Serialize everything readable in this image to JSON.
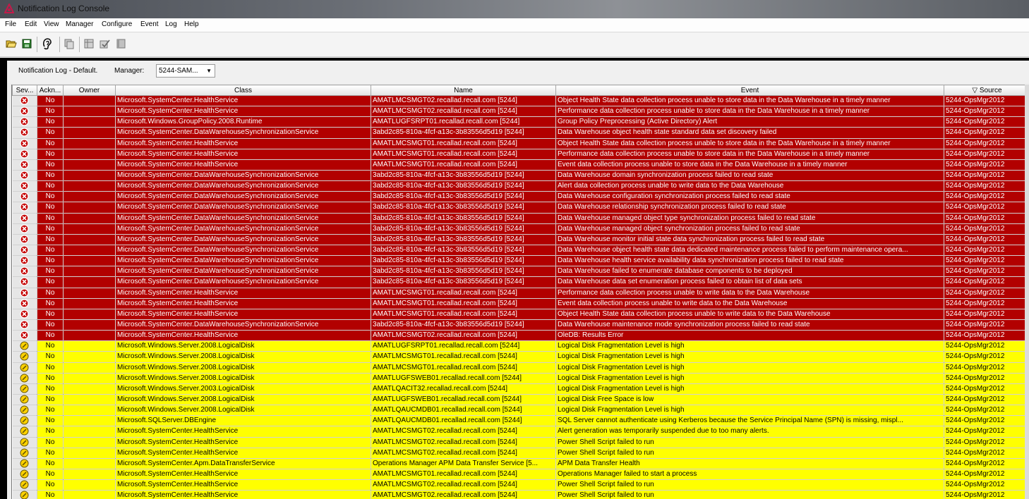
{
  "window": {
    "title": "Notification Log Console"
  },
  "menu": [
    "File",
    "Edit",
    "View",
    "Manager",
    "Configure",
    "Event",
    "Log",
    "Help"
  ],
  "toolbar": [
    "open-folder-icon",
    "save-icon",
    "ear-icon",
    "copy-icon",
    "grid-icon",
    "edit-check-icon",
    "book-icon"
  ],
  "filter": {
    "label": "Notification Log - Default.",
    "manager_label": "Manager:",
    "manager_value": "5244-SAM..."
  },
  "colors": {
    "critical": "#b20000",
    "warning": "#ffff00"
  },
  "columns": [
    "Sev...",
    "Ackn...",
    "Owner",
    "Class",
    "Name",
    "Event",
    "Source"
  ],
  "sort": {
    "column": "Source",
    "indicator": "▽"
  },
  "rows": [
    {
      "severity": "critical",
      "ack": "No",
      "owner": "",
      "class": "Microsoft.SystemCenter.HealthService",
      "name": "AMATLMCSMGT02.recallad.recall.com [5244]",
      "event": "Object Health State data collection process unable to store data in the Data Warehouse in a timely manner",
      "source": "5244-OpsMgr2012"
    },
    {
      "severity": "critical",
      "ack": "No",
      "owner": "",
      "class": "Microsoft.SystemCenter.HealthService",
      "name": "AMATLMCSMGT02.recallad.recall.com [5244]",
      "event": "Performance data collection process unable to store data in the Data Warehouse in a timely manner",
      "source": "5244-OpsMgr2012"
    },
    {
      "severity": "critical",
      "ack": "No",
      "owner": "",
      "class": "Microsoft.Windows.GroupPolicy.2008.Runtime",
      "name": "AMATLUGFSRPT01.recallad.recall.com [5244]",
      "event": "Group Policy Preprocessing (Active Directory) Alert",
      "source": "5244-OpsMgr2012"
    },
    {
      "severity": "critical",
      "ack": "No",
      "owner": "",
      "class": "Microsoft.SystemCenter.DataWarehouseSynchronizationService",
      "name": "3abd2c85-810a-4fcf-a13c-3b83556d5d19 [5244]",
      "event": "Data Warehouse object health state standard data set discovery failed",
      "source": "5244-OpsMgr2012"
    },
    {
      "severity": "critical",
      "ack": "No",
      "owner": "",
      "class": "Microsoft.SystemCenter.HealthService",
      "name": "AMATLMCSMGT01.recallad.recall.com [5244]",
      "event": "Object Health State data collection process unable to store data in the Data Warehouse in a timely manner",
      "source": "5244-OpsMgr2012"
    },
    {
      "severity": "critical",
      "ack": "No",
      "owner": "",
      "class": "Microsoft.SystemCenter.HealthService",
      "name": "AMATLMCSMGT01.recallad.recall.com [5244]",
      "event": "Performance data collection process unable to store data in the Data Warehouse in a timely manner",
      "source": "5244-OpsMgr2012"
    },
    {
      "severity": "critical",
      "ack": "No",
      "owner": "",
      "class": "Microsoft.SystemCenter.HealthService",
      "name": "AMATLMCSMGT01.recallad.recall.com [5244]",
      "event": "Event data collection process unable to store data in the Data Warehouse in a timely manner",
      "source": "5244-OpsMgr2012"
    },
    {
      "severity": "critical",
      "ack": "No",
      "owner": "",
      "class": "Microsoft.SystemCenter.DataWarehouseSynchronizationService",
      "name": "3abd2c85-810a-4fcf-a13c-3b83556d5d19 [5244]",
      "event": "Data Warehouse domain synchronization process failed to read state",
      "source": "5244-OpsMgr2012"
    },
    {
      "severity": "critical",
      "ack": "No",
      "owner": "",
      "class": "Microsoft.SystemCenter.DataWarehouseSynchronizationService",
      "name": "3abd2c85-810a-4fcf-a13c-3b83556d5d19 [5244]",
      "event": "Alert data collection process unable to write data to the Data Warehouse",
      "source": "5244-OpsMgr2012"
    },
    {
      "severity": "critical",
      "ack": "No",
      "owner": "",
      "class": "Microsoft.SystemCenter.DataWarehouseSynchronizationService",
      "name": "3abd2c85-810a-4fcf-a13c-3b83556d5d19 [5244]",
      "event": "Data Warehouse configuration synchronization process failed to read state",
      "source": "5244-OpsMgr2012"
    },
    {
      "severity": "critical",
      "ack": "No",
      "owner": "",
      "class": "Microsoft.SystemCenter.DataWarehouseSynchronizationService",
      "name": "3abd2c85-810a-4fcf-a13c-3b83556d5d19 [5244]",
      "event": "Data Warehouse relationship synchronization process failed to read state",
      "source": "5244-OpsMgr2012"
    },
    {
      "severity": "critical",
      "ack": "No",
      "owner": "",
      "class": "Microsoft.SystemCenter.DataWarehouseSynchronizationService",
      "name": "3abd2c85-810a-4fcf-a13c-3b83556d5d19 [5244]",
      "event": "Data Warehouse managed object type synchronization process failed to read state",
      "source": "5244-OpsMgr2012"
    },
    {
      "severity": "critical",
      "ack": "No",
      "owner": "",
      "class": "Microsoft.SystemCenter.DataWarehouseSynchronizationService",
      "name": "3abd2c85-810a-4fcf-a13c-3b83556d5d19 [5244]",
      "event": "Data Warehouse managed object synchronization process failed to read state",
      "source": "5244-OpsMgr2012"
    },
    {
      "severity": "critical",
      "ack": "No",
      "owner": "",
      "class": "Microsoft.SystemCenter.DataWarehouseSynchronizationService",
      "name": "3abd2c85-810a-4fcf-a13c-3b83556d5d19 [5244]",
      "event": "Data Warehouse monitor initial state data synchronization process failed to read state",
      "source": "5244-OpsMgr2012"
    },
    {
      "severity": "critical",
      "ack": "No",
      "owner": "",
      "class": "Microsoft.SystemCenter.DataWarehouseSynchronizationService",
      "name": "3abd2c85-810a-4fcf-a13c-3b83556d5d19 [5244]",
      "event": "Data Warehouse object health state data dedicated maintenance process failed to perform maintenance opera...",
      "source": "5244-OpsMgr2012"
    },
    {
      "severity": "critical",
      "ack": "No",
      "owner": "",
      "class": "Microsoft.SystemCenter.DataWarehouseSynchronizationService",
      "name": "3abd2c85-810a-4fcf-a13c-3b83556d5d19 [5244]",
      "event": "Data Warehouse health service availability data synchronization process failed to read state",
      "source": "5244-OpsMgr2012"
    },
    {
      "severity": "critical",
      "ack": "No",
      "owner": "",
      "class": "Microsoft.SystemCenter.DataWarehouseSynchronizationService",
      "name": "3abd2c85-810a-4fcf-a13c-3b83556d5d19 [5244]",
      "event": "Data Warehouse failed to enumerate database components to be deployed",
      "source": "5244-OpsMgr2012"
    },
    {
      "severity": "critical",
      "ack": "No",
      "owner": "",
      "class": "Microsoft.SystemCenter.DataWarehouseSynchronizationService",
      "name": "3abd2c85-810a-4fcf-a13c-3b83556d5d19 [5244]",
      "event": "Data Warehouse data set enumeration process failed to obtain list of data sets",
      "source": "5244-OpsMgr2012"
    },
    {
      "severity": "critical",
      "ack": "No",
      "owner": "",
      "class": "Microsoft.SystemCenter.HealthService",
      "name": "AMATLMCSMGT01.recallad.recall.com [5244]",
      "event": "Performance data collection process unable to write data to the Data Warehouse",
      "source": "5244-OpsMgr2012"
    },
    {
      "severity": "critical",
      "ack": "No",
      "owner": "",
      "class": "Microsoft.SystemCenter.HealthService",
      "name": "AMATLMCSMGT01.recallad.recall.com [5244]",
      "event": "Event data collection process unable to write data to the Data Warehouse",
      "source": "5244-OpsMgr2012"
    },
    {
      "severity": "critical",
      "ack": "No",
      "owner": "",
      "class": "Microsoft.SystemCenter.HealthService",
      "name": "AMATLMCSMGT01.recallad.recall.com [5244]",
      "event": "Object Health State data collection process unable to write data to the Data Warehouse",
      "source": "5244-OpsMgr2012"
    },
    {
      "severity": "critical",
      "ack": "No",
      "owner": "",
      "class": "Microsoft.SystemCenter.DataWarehouseSynchronizationService",
      "name": "3abd2c85-810a-4fcf-a13c-3b83556d5d19 [5244]",
      "event": "Data Warehouse maintenance mode synchronization process failed to read state",
      "source": "5244-OpsMgr2012"
    },
    {
      "severity": "critical",
      "ack": "No",
      "owner": "",
      "class": "Microsoft.SystemCenter.HealthService",
      "name": "AMATLMCSMGT02.recallad.recall.com [5244]",
      "event": "OleDB: Results Error",
      "source": "5244-OpsMgr2012"
    },
    {
      "severity": "warning",
      "ack": "No",
      "owner": "",
      "class": "Microsoft.Windows.Server.2008.LogicalDisk",
      "name": "AMATLUGFSRPT01.recallad.recall.com [5244]",
      "event": "Logical Disk Fragmentation Level is high",
      "source": "5244-OpsMgr2012"
    },
    {
      "severity": "warning",
      "ack": "No",
      "owner": "",
      "class": "Microsoft.Windows.Server.2008.LogicalDisk",
      "name": "AMATLMCSMGT01.recallad.recall.com [5244]",
      "event": "Logical Disk Fragmentation Level is high",
      "source": "5244-OpsMgr2012"
    },
    {
      "severity": "warning",
      "ack": "No",
      "owner": "",
      "class": "Microsoft.Windows.Server.2008.LogicalDisk",
      "name": "AMATLMCSMGT01.recallad.recall.com [5244]",
      "event": "Logical Disk Fragmentation Level is high",
      "source": "5244-OpsMgr2012"
    },
    {
      "severity": "warning",
      "ack": "No",
      "owner": "",
      "class": "Microsoft.Windows.Server.2008.LogicalDisk",
      "name": "AMATLUGFSWEB01.recallad.recall.com [5244]",
      "event": "Logical Disk Fragmentation Level is high",
      "source": "5244-OpsMgr2012"
    },
    {
      "severity": "warning",
      "ack": "No",
      "owner": "",
      "class": "Microsoft.Windows.Server.2003.LogicalDisk",
      "name": "AMATLQACIT32.recallad.recall.com [5244]",
      "event": "Logical Disk Fragmentation Level is high",
      "source": "5244-OpsMgr2012"
    },
    {
      "severity": "warning",
      "ack": "No",
      "owner": "",
      "class": "Microsoft.Windows.Server.2008.LogicalDisk",
      "name": "AMATLUGFSWEB01.recallad.recall.com [5244]",
      "event": "Logical Disk Free Space is low",
      "source": "5244-OpsMgr2012"
    },
    {
      "severity": "warning",
      "ack": "No",
      "owner": "",
      "class": "Microsoft.Windows.Server.2008.LogicalDisk",
      "name": "AMATLQAUCMDB01.recallad.recall.com [5244]",
      "event": "Logical Disk Fragmentation Level is high",
      "source": "5244-OpsMgr2012"
    },
    {
      "severity": "warning",
      "ack": "No",
      "owner": "",
      "class": "Microsoft.SQLServer.DBEngine",
      "name": "AMATLQAUCMDB01.recallad.recall.com [5244]",
      "event": "SQL Server cannot authenticate using Kerberos because the Service Principal Name (SPN) is missing, mispl...",
      "source": "5244-OpsMgr2012"
    },
    {
      "severity": "warning",
      "ack": "No",
      "owner": "",
      "class": "Microsoft.SystemCenter.HealthService",
      "name": "AMATLMCSMGT02.recallad.recall.com [5244]",
      "event": "Alert generation was temporarily suspended due to too many alerts.",
      "source": "5244-OpsMgr2012"
    },
    {
      "severity": "warning",
      "ack": "No",
      "owner": "",
      "class": "Microsoft.SystemCenter.HealthService",
      "name": "AMATLMCSMGT02.recallad.recall.com [5244]",
      "event": "Power Shell Script failed to run",
      "source": "5244-OpsMgr2012"
    },
    {
      "severity": "warning",
      "ack": "No",
      "owner": "",
      "class": "Microsoft.SystemCenter.HealthService",
      "name": "AMATLMCSMGT02.recallad.recall.com [5244]",
      "event": "Power Shell Script failed to run",
      "source": "5244-OpsMgr2012"
    },
    {
      "severity": "warning",
      "ack": "No",
      "owner": "",
      "class": "Microsoft.SystemCenter.Apm.DataTransferService",
      "name": "Operations Manager APM Data Transfer Service [5...",
      "event": "APM Data Transfer Health",
      "source": "5244-OpsMgr2012"
    },
    {
      "severity": "warning",
      "ack": "No",
      "owner": "",
      "class": "Microsoft.SystemCenter.HealthService",
      "name": "AMATLMCSMGT01.recallad.recall.com [5244]",
      "event": "Operations Manager failed to start a process",
      "source": "5244-OpsMgr2012"
    },
    {
      "severity": "warning",
      "ack": "No",
      "owner": "",
      "class": "Microsoft.SystemCenter.HealthService",
      "name": "AMATLMCSMGT02.recallad.recall.com [5244]",
      "event": "Power Shell Script failed to run",
      "source": "5244-OpsMgr2012"
    },
    {
      "severity": "warning",
      "ack": "No",
      "owner": "",
      "class": "Microsoft.SystemCenter.HealthService",
      "name": "AMATLMCSMGT02.recallad.recall.com [5244]",
      "event": "Power Shell Script failed to run",
      "source": "5244-OpsMgr2012"
    }
  ]
}
